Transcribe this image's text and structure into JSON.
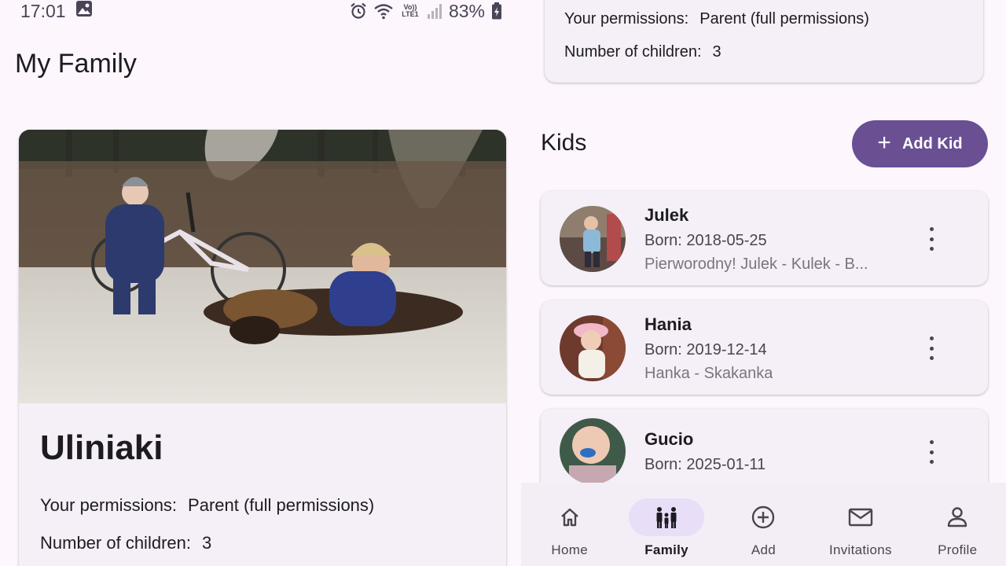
{
  "status_bar": {
    "time": "17:01",
    "network": "Vo)) LTE1",
    "battery": "83%"
  },
  "page": {
    "title": "My Family"
  },
  "family": {
    "name": "Uliniaki",
    "permissions_label": "Your permissions:",
    "permissions_value": "Parent (full permissions)",
    "children_label": "Number of children:",
    "children_value": "3"
  },
  "kids_section": {
    "heading": "Kids",
    "add_button_label": "Add Kid",
    "kids": [
      {
        "name": "Julek",
        "born": "Born: 2018-05-25",
        "note": "Pierworodny! Julek - Kulek - B..."
      },
      {
        "name": "Hania",
        "born": "Born: 2019-12-14",
        "note": "Hanka - Skakanka"
      },
      {
        "name": "Gucio",
        "born": "Born: 2025-01-11",
        "note": ""
      }
    ]
  },
  "bottom_nav": {
    "items": [
      {
        "label": "Home",
        "icon": "home-icon",
        "active": false
      },
      {
        "label": "Family",
        "icon": "family-icon",
        "active": true
      },
      {
        "label": "Add",
        "icon": "add-circle-icon",
        "active": false
      },
      {
        "label": "Invitations",
        "icon": "mail-icon",
        "active": false
      },
      {
        "label": "Profile",
        "icon": "person-icon",
        "active": false
      }
    ]
  },
  "colors": {
    "background": "#fdf7fd",
    "card": "#f5eff7",
    "accent": "#6a4f93",
    "nav_active_pill": "#e8def8"
  }
}
